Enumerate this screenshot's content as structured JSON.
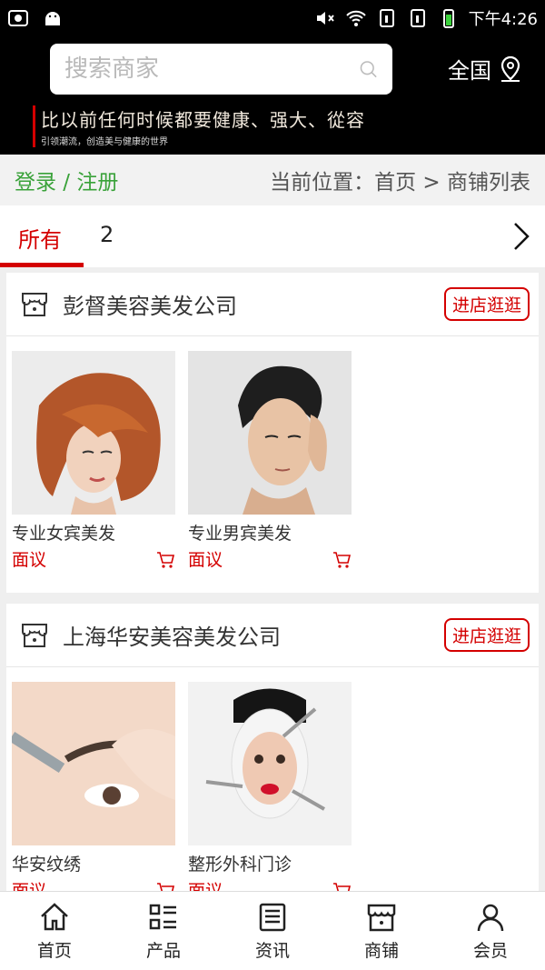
{
  "status_bar": {
    "time": "下午4:26"
  },
  "header": {
    "search_placeholder": "搜索商家",
    "region": "全国",
    "banner_title": "比以前任何时候都要健康、强大、從容",
    "banner_sub": "引领潮流，创造美与健康的世界"
  },
  "crumbs": {
    "login": "登录 / 注册",
    "location": "当前位置：首页 > 商铺列表"
  },
  "tabs": [
    {
      "label": "所有"
    },
    {
      "label": "2"
    }
  ],
  "shops": [
    {
      "name": "彭督美容美发公司",
      "visit_label": "进店逛逛",
      "products": [
        {
          "title": "专业女宾美发",
          "price": "面议"
        },
        {
          "title": "专业男宾美发",
          "price": "面议"
        }
      ]
    },
    {
      "name": "上海华安美容美发公司",
      "visit_label": "进店逛逛",
      "products": [
        {
          "title": "华安纹绣",
          "price": "面议"
        },
        {
          "title": "整形外科门诊",
          "price": "面议"
        }
      ]
    }
  ],
  "bottom_nav": [
    {
      "label": "首页",
      "icon": "home-icon"
    },
    {
      "label": "产品",
      "icon": "list-icon"
    },
    {
      "label": "资讯",
      "icon": "news-icon"
    },
    {
      "label": "商铺",
      "icon": "store-icon"
    },
    {
      "label": "会员",
      "icon": "user-icon"
    }
  ],
  "colors": {
    "accent": "#d40000",
    "login_green": "#3aa23a",
    "header_bg": "#000000"
  }
}
